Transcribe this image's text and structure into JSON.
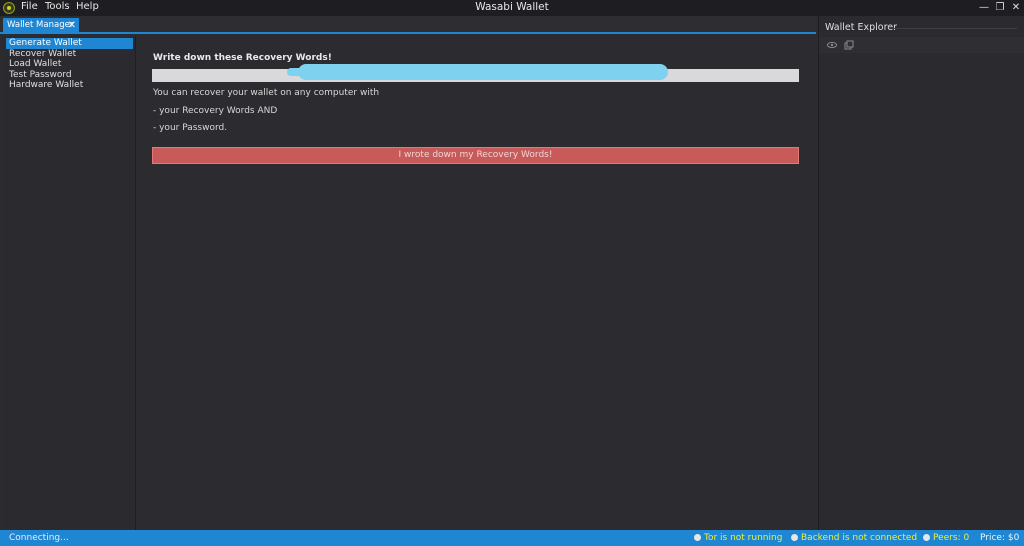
{
  "window": {
    "title": "Wasabi Wallet",
    "menu": [
      "File",
      "Tools",
      "Help"
    ],
    "controls": {
      "minimize": "—",
      "restore": "❐",
      "close": "✕"
    }
  },
  "tab": {
    "label": "Wallet Manager",
    "close": "✕"
  },
  "nav": {
    "items": [
      "Generate Wallet",
      "Recover Wallet",
      "Load Wallet",
      "Test Password",
      "Hardware Wallet"
    ],
    "active_index": 0
  },
  "main": {
    "heading": "Write down these Recovery Words!",
    "line1": "You can recover your wallet on any computer with",
    "line2": "- your Recovery Words AND",
    "line3": "- your Password.",
    "button": "I wrote down my Recovery Words!"
  },
  "explorer": {
    "title": "Wallet Explorer"
  },
  "status": {
    "left": "Connecting...",
    "tor": "Tor is not running",
    "backend": "Backend is not connected",
    "peers": "Peers: 0",
    "price": "Price: $0"
  },
  "colors": {
    "accent": "#1f86d4",
    "danger_button": "#c85a5a",
    "status_warning": "#ecef3c"
  }
}
